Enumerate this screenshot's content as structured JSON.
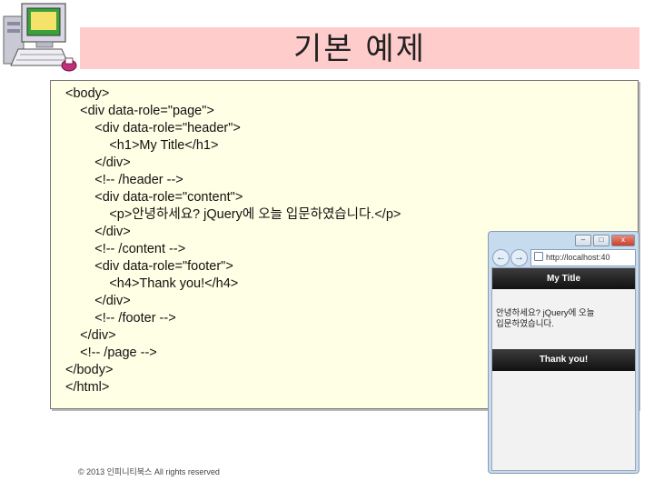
{
  "slide": {
    "title": "기본 예제",
    "copyright": "© 2013 인피니티북스 All rights reserved"
  },
  "code_lines": [
    "<body>",
    "    <div data-role=\"page\">",
    "        <div data-role=\"header\">",
    "            <h1>My Title</h1>",
    "        </div>",
    "        <!-- /header -->",
    "        <div data-role=\"content\">",
    "            <p>안녕하세요? jQuery에 오늘 입문하였습니다.</p>",
    "        </div>",
    "        <!-- /content -->",
    "        <div data-role=\"footer\">",
    "            <h4>Thank you!</h4>",
    "        </div>",
    "        <!-- /footer -->",
    "    </div>",
    "    <!-- /page -->",
    "</body>",
    "</html>"
  ],
  "browser": {
    "controls": {
      "minimize": "–",
      "maximize": "□",
      "close": "x"
    },
    "back_glyph": "←",
    "forward_glyph": "→",
    "address": "http://localhost:40",
    "header_title": "My Title",
    "content_line1": "안녕하세요? jQuery에 오늘",
    "content_line2": "입문하였습니다.",
    "footer_title": "Thank you!"
  },
  "icons": {
    "clipart": "computer-clipart-icon",
    "address": "page-icon"
  }
}
